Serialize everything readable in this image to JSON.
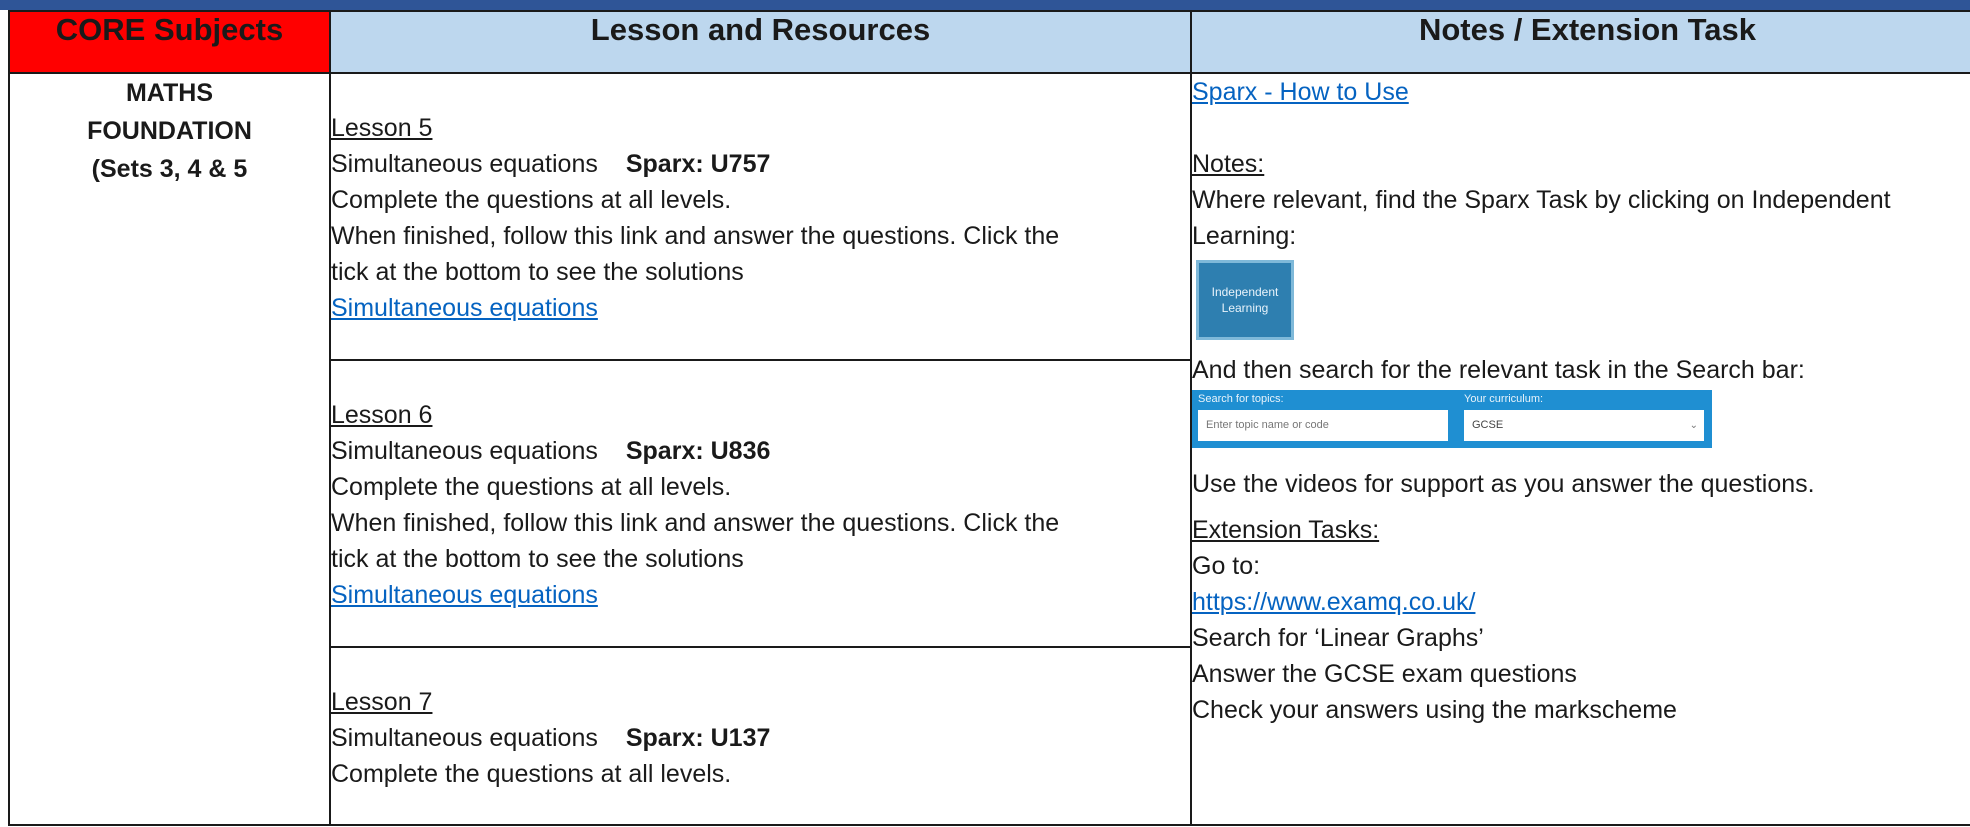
{
  "header": {
    "col1": "CORE Subjects",
    "col2": "Lesson and Resources",
    "col3": "Notes / Extension Task"
  },
  "subject": {
    "line1": "MATHS",
    "line2": "FOUNDATION",
    "line3": "(Sets 3, 4 & 5"
  },
  "lessons": [
    {
      "title": "Lesson 5",
      "topic": "Simultaneous equations",
      "sparx": "Sparx: U757",
      "instruction": "Complete the questions at all levels.",
      "followup1": "When finished, follow this link and answer the questions. Click the",
      "followup2": "tick at the bottom to see the solutions",
      "link": "Simultaneous equations"
    },
    {
      "title": "Lesson 6",
      "topic": "Simultaneous equations",
      "sparx": "Sparx: U836",
      "instruction": "Complete the questions at all levels.",
      "followup1": "When finished, follow this link and answer the questions. Click the",
      "followup2": "tick at the bottom to see the solutions",
      "link": "Simultaneous equations"
    },
    {
      "title": "Lesson 7",
      "topic": "Simultaneous equations",
      "sparx": "Sparx: U137",
      "instruction": "Complete the questions at all levels."
    }
  ],
  "notes": {
    "sparx_link": "Sparx - How to Use",
    "notes_heading": "Notes:",
    "notes_line1": "Where relevant, find the Sparx Task by clicking on Independent",
    "notes_line2": "Learning:",
    "il_button_line1": "Independent",
    "il_button_line2": "Learning",
    "search_line": "And then search for the relevant task in the Search bar:",
    "search_label_topics": "Search for topics:",
    "search_label_curriculum": "Your curriculum:",
    "search_placeholder": "Enter topic name or code",
    "curriculum_value": "GCSE",
    "videos_line": "Use the videos for support as you answer the questions.",
    "extension_heading": "Extension Tasks:",
    "goto": "Go to:",
    "examq_link": "https://www.examq.co.uk/",
    "ext_line1": "Search for ‘Linear Graphs’",
    "ext_line2": "Answer the GCSE exam questions",
    "ext_line3": "Check your answers using the markscheme"
  },
  "icons": {
    "dropdown": "chevron-down-icon"
  },
  "colors": {
    "core_header": "#ff0000",
    "column_header": "#bdd7ee",
    "top_bar": "#2f5597",
    "link": "#0563c1"
  }
}
